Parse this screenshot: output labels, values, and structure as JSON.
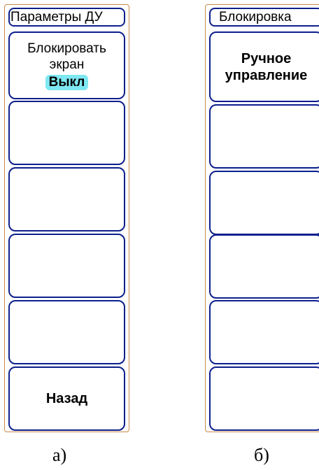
{
  "panel_a": {
    "title": "Параметры ДУ",
    "lock_screen_label_line1": "Блокировать",
    "lock_screen_label_line2": "экран",
    "lock_screen_state": "Выкл",
    "back_label": "Назад",
    "caption": "а)"
  },
  "panel_b": {
    "title": "Блокировка",
    "manual_control_line1": "Ручное",
    "manual_control_line2": "управление",
    "caption": "б)"
  }
}
